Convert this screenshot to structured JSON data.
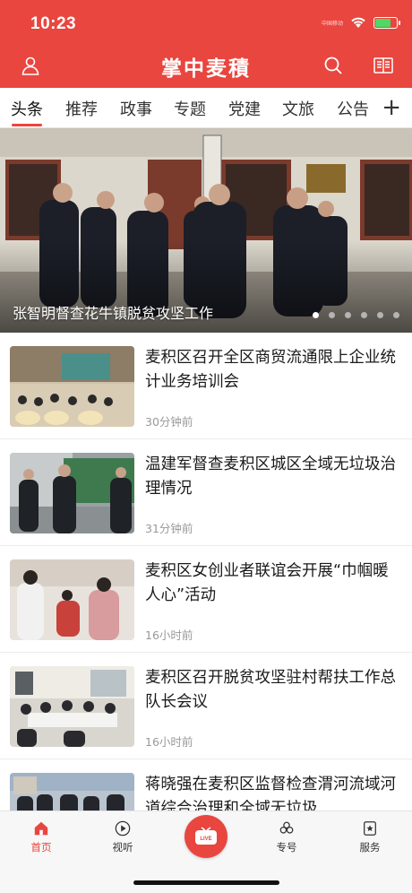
{
  "status": {
    "time": "10:23",
    "carrier": "中国移动",
    "battery": 0.75
  },
  "nav": {
    "title": "掌中麦積"
  },
  "tabs": [
    {
      "label": "头条"
    },
    {
      "label": "推荐"
    },
    {
      "label": "政事"
    },
    {
      "label": "专题"
    },
    {
      "label": "党建"
    },
    {
      "label": "文旅"
    },
    {
      "label": "公告"
    }
  ],
  "tab_add": "+",
  "banner": {
    "caption": "张智明督查花牛镇脱贫攻坚工作",
    "slides_total": 6,
    "active_slide": 1
  },
  "news": [
    {
      "title": "麦积区召开全区商贸流通限上企业统计业务培训会",
      "time": "30分钟前"
    },
    {
      "title": "温建军督查麦积区城区全域无垃圾治理情况",
      "time": "31分钟前"
    },
    {
      "title": "麦积区女创业者联谊会开展“巾帼暖人心”活动",
      "time": "16小时前"
    },
    {
      "title": "麦积区召开脱贫攻坚驻村帮扶工作总队长会议",
      "time": "16小时前"
    },
    {
      "title": "蒋晓强在麦积区监督检查渭河流域河道综合治理和全域无垃圾",
      "time": ""
    }
  ],
  "tabbar": {
    "home": "首页",
    "video": "视听",
    "live": "LIVE",
    "special": "专号",
    "service": "服务"
  },
  "colors": {
    "accent": "#e8463f"
  }
}
